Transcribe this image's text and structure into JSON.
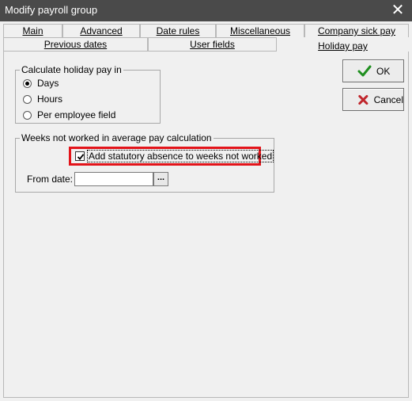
{
  "window": {
    "title": "Modify payroll group",
    "close_glyph": "✕"
  },
  "tabs_row1": [
    {
      "label": "Main"
    },
    {
      "label": "Advanced"
    },
    {
      "label": "Date rules"
    },
    {
      "label": "Miscellaneous"
    },
    {
      "label": "Company sick pay"
    }
  ],
  "tabs_row2": [
    {
      "label": "Previous dates"
    },
    {
      "label": "User fields"
    },
    {
      "label": "Holiday pay",
      "active": true
    }
  ],
  "holiday_group": {
    "legend": "Calculate holiday pay in",
    "options": [
      {
        "label": "Days",
        "selected": true
      },
      {
        "label": "Hours",
        "selected": false
      },
      {
        "label": "Per employee field",
        "selected": false
      }
    ]
  },
  "weeks_group": {
    "legend": "Weeks not worked in average pay calculation",
    "checkbox_label": "Add statutory absence to weeks not worked",
    "checked": true,
    "from_date_label": "From date:",
    "from_date_value": "",
    "browse_label": "..."
  },
  "buttons": {
    "ok_label": "OK",
    "cancel_label": "Cancel"
  },
  "colors": {
    "titlebar": "#4a4a4a",
    "highlight": "#e3141a",
    "ok_icon": "#1f8f1f",
    "cancel_icon": "#c0262c"
  }
}
